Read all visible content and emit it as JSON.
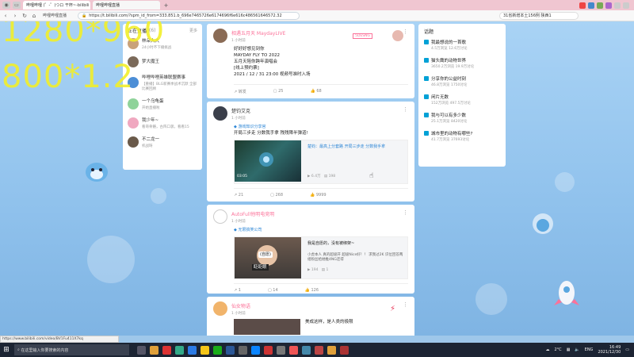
{
  "browser": {
    "tabs": [
      {
        "label": "哔哩哔哩 (゜-゜)つロ 干杯~-bilibili",
        "active": true
      },
      {
        "label": "哔哩哔哩直播",
        "active": false
      }
    ],
    "address": "https://t.bilibili.com/?spm_id_from=333.851.b_696e7465726e6174696f6e616c486561646572.32",
    "bookmark": "哔哩哔哩直播",
    "search_text": "31省新增本土156例 陕西1"
  },
  "overlay": {
    "line1": "1280*960",
    "line2": "800*1.2"
  },
  "left_panel": {
    "header": "正在直播",
    "count": "(6)",
    "more": "更多",
    "items": [
      {
        "name": "林朵大大",
        "sub": "24小时不下播挑战",
        "color": "#c9a27a"
      },
      {
        "name": "梦大魔王",
        "sub": "",
        "color": "#7b6a5a"
      },
      {
        "name": "哔哩哔哩英雄联盟赛事",
        "sub": "【重播】BLG新赛季战术沉默 全部比赛回顾",
        "color": "#4c8ed6"
      },
      {
        "name": "一个乌龟蛋",
        "sub": "开始直播啦",
        "color": "#8fd39a"
      },
      {
        "name": "我少年~",
        "sub": "看哥骨骼，古阵口袭，看看15",
        "color": "#f0a8c0"
      },
      {
        "name": "不二龙一",
        "sub": "机战呀",
        "color": "#6a5a4a"
      }
    ]
  },
  "feed": [
    {
      "user": "相遇五月天 MaydayLIVE",
      "time": "1 小时前",
      "badge": "5DESNG",
      "lines": [
        "好好好想见到你",
        "MAYDAY FLY TO 2022",
        "五月天陪你跨年演唱会",
        "[线上预约票]",
        "2021 / 12 / 31 23:00 视频号准时入场"
      ],
      "actions": [
        "转发",
        "25",
        "68"
      ]
    },
    {
      "user": "楚钧艾克",
      "time": "1 小时前",
      "tag": "游戏知识分享官",
      "text": "开局三步走 分数我手拿 残残障半弹道!",
      "video_title": "楚钧：最高上分套路 开局三步走 分数我手拿",
      "duration": "03:05",
      "views": "6.4万",
      "danmaku": "198",
      "actions": [
        "21",
        "268",
        "9999"
      ]
    },
    {
      "user": "AutoFull他明电竞明",
      "time": "1 小时前",
      "tag": "无限搞笑公司",
      "video_title": "我是自愿的，没有被绑架~",
      "video_desc": "小虎本人 真的超级开 超级Nice好！！ 求我过2K 识位回答两组粉丝给她推4NG还得",
      "thumb_label1": "(自愿)",
      "thumb_label2": "眨眨眼",
      "views": "194",
      "danmaku": "1",
      "actions": [
        "1",
        "14",
        "126"
      ]
    },
    {
      "user": "仙女物语",
      "time": "1 小时前",
      "video_title": "美成这样，是人类的极限"
    }
  ],
  "topics": {
    "title": "话题",
    "items": [
      {
        "name": "我最想说的一首歌",
        "sub": "4.5万浏览 12.6万讨论"
      },
      {
        "name": "猫头鹰的动物世界",
        "sub": "3650.2万浏览 19.9万讨论"
      },
      {
        "name": "分享你的公益时刻",
        "sub": "46.8万浏览 1750讨论"
      },
      {
        "name": "闲片无数",
        "sub": "152万浏览 497.5万讨论"
      },
      {
        "name": "我与可以有多少数",
        "sub": "25.1万浏览 8420讨论"
      },
      {
        "name": "城市里的动物有哪些?",
        "sub": "41.7万浏览 37693讨论"
      }
    ]
  },
  "statusbar": "https://www.bilibili.com/video/BV1Fu411X7kq",
  "taskbar": {
    "search_placeholder": "在这里输入你要搜索的内容",
    "weather": "2°C",
    "lang": "ENG",
    "time": "16:49",
    "date": "2021/12/30"
  },
  "colors": {
    "accent": "#fb7299",
    "link": "#00a1d6"
  }
}
